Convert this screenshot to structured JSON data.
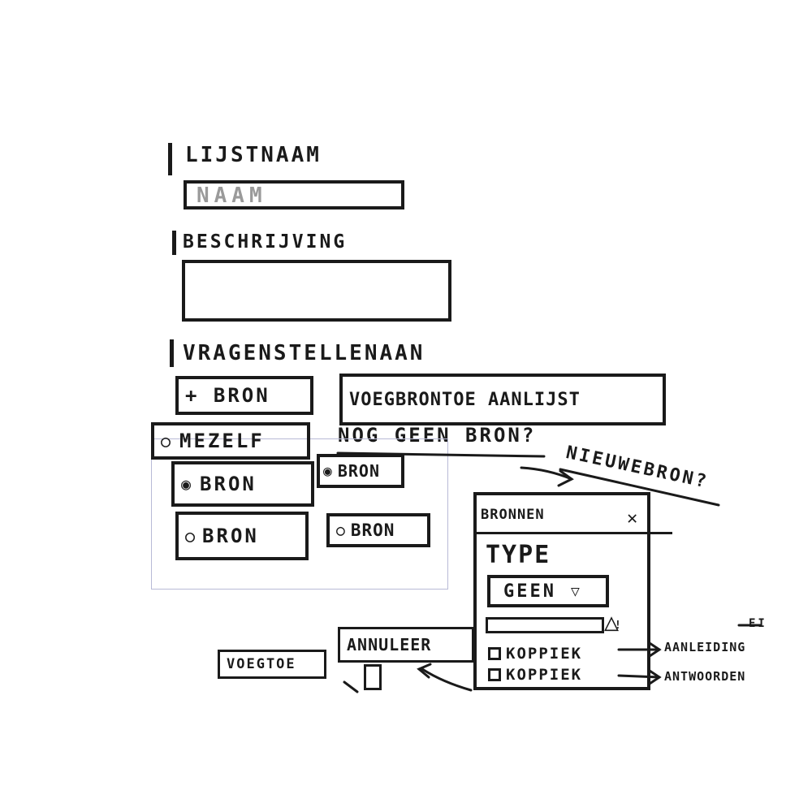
{
  "form": {
    "name_label": "LIJSTNAAM",
    "name_placeholder": "NAAM",
    "description_label": "BESCHRIJVING",
    "questions_label": "VRAGENSTELLENAAN",
    "add_source_button": "+ BRON",
    "add_source_to_list_button": "VOEGBRONTOE AANLIJST",
    "no_source_text": "NOG GEEN BRON?",
    "new_source_text": "NIEUWEBRON?",
    "options": [
      {
        "label": "MEZELF",
        "icon": "radio-icon"
      },
      {
        "label": "BRON",
        "icon": "radio-selected-icon"
      },
      {
        "label": "BRON",
        "icon": "radio-selected-icon"
      },
      {
        "label": "BRON",
        "icon": "radio-icon"
      },
      {
        "label": "BRON",
        "icon": "radio-icon"
      }
    ],
    "add_button": "VOEGTOE",
    "cancel_button": "ANNULEER"
  },
  "dialog": {
    "title": "BRONNEN",
    "close_icon": "close-icon",
    "type_label": "TYPE",
    "type_value": "GEEN",
    "warning_icon": "warning-icon",
    "checkbox1_label": "KOPPIEK",
    "checkbox2_label": "KOPPIEK",
    "target1": "AANLEIDING",
    "target2": "ANTWOORDEN",
    "edge_mark": "EI"
  }
}
